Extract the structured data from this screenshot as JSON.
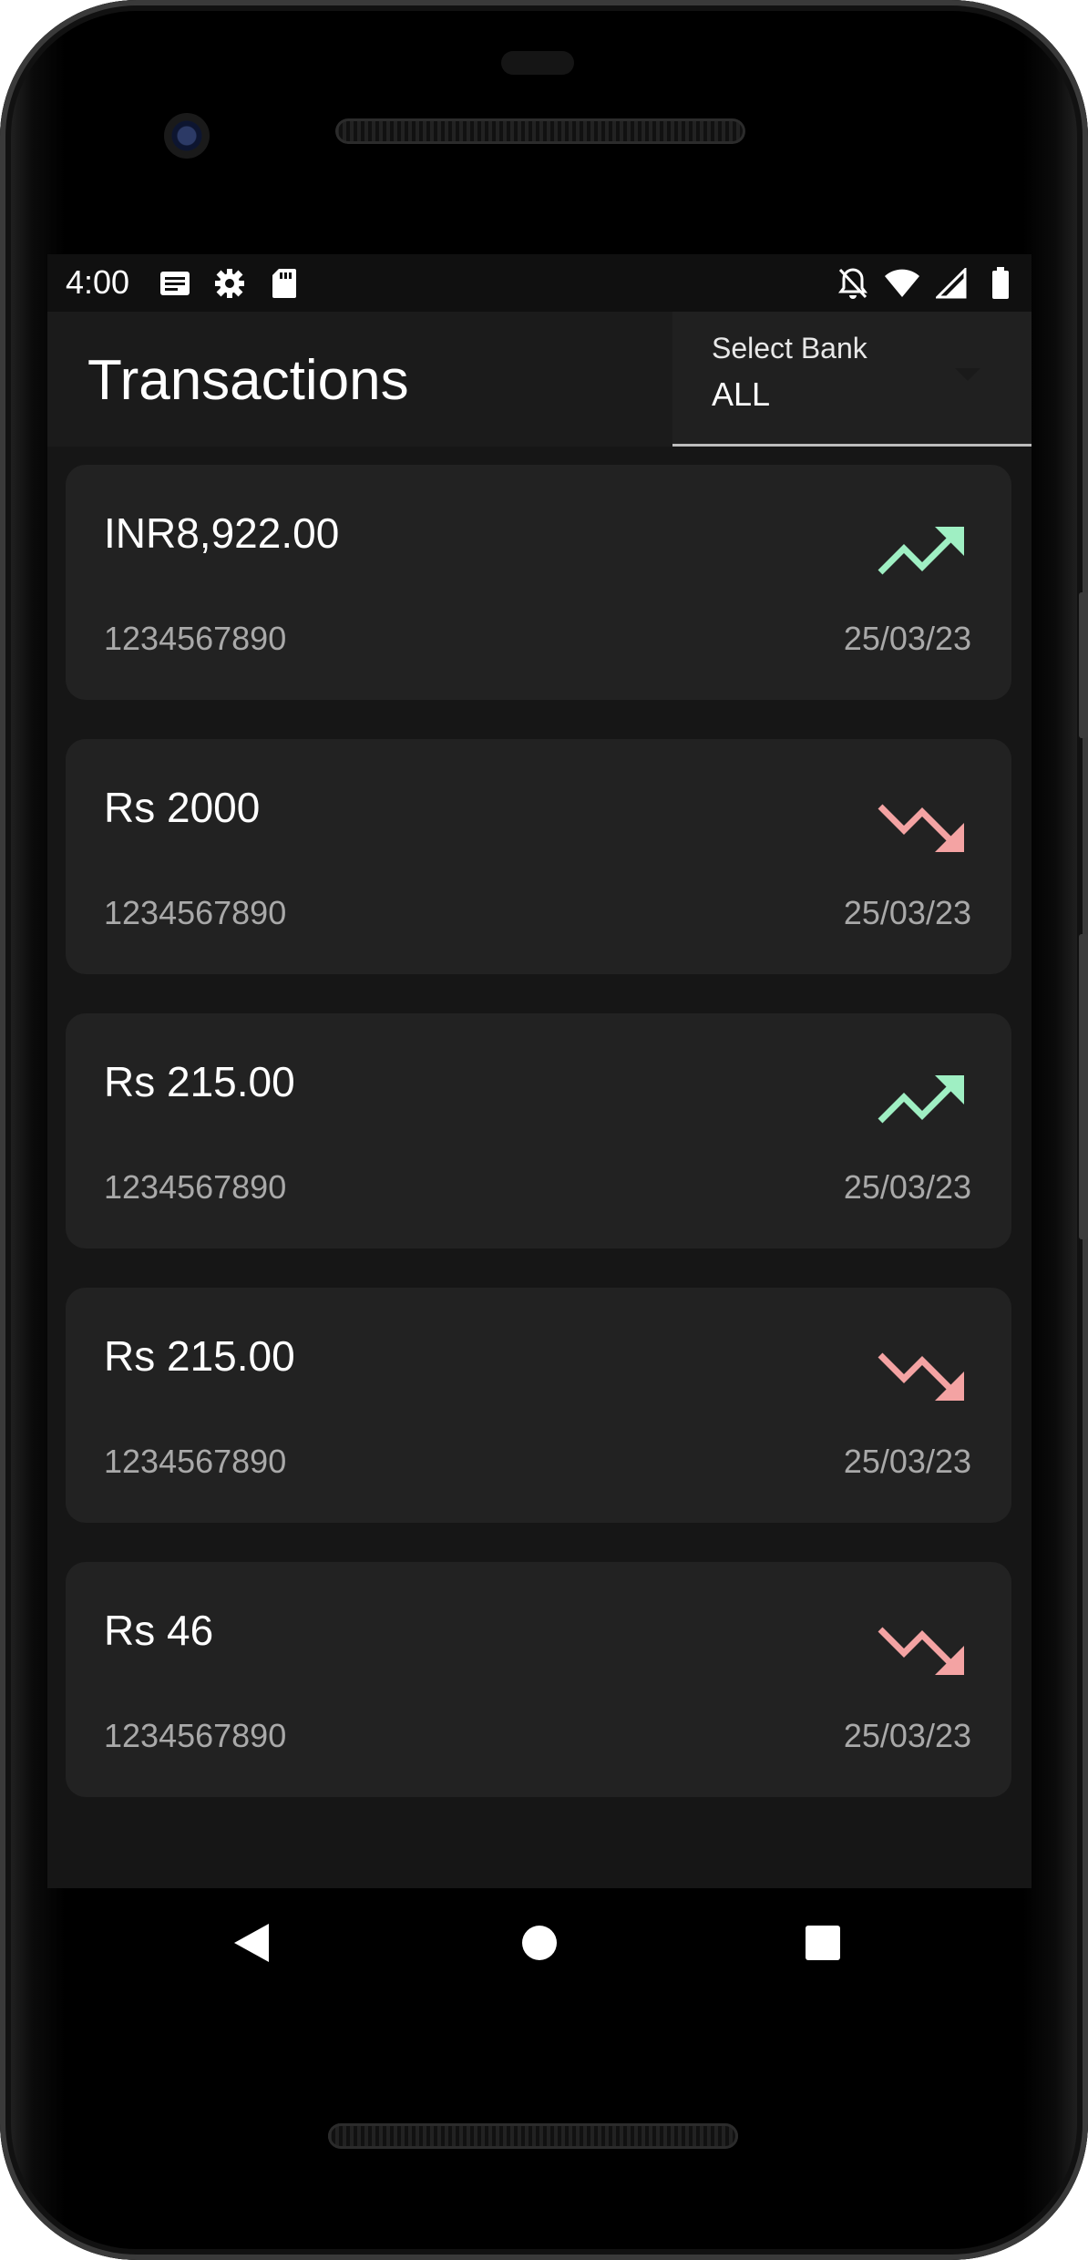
{
  "status_bar": {
    "time": "4:00",
    "left_icons": [
      "news-icon",
      "settings-icon",
      "sd-card-icon"
    ],
    "right_icons": [
      "notifications-off-icon",
      "wifi-icon",
      "signal-icon",
      "battery-icon"
    ]
  },
  "header": {
    "title": "Transactions",
    "bank_select": {
      "label": "Select Bank",
      "value": "ALL"
    }
  },
  "transactions": [
    {
      "amount": "INR8,922.00",
      "account": "1234567890",
      "date": "25/03/23",
      "direction": "credit",
      "icon": "trending-up-icon"
    },
    {
      "amount": "Rs 2000",
      "account": "1234567890",
      "date": "25/03/23",
      "direction": "debit",
      "icon": "trending-down-icon"
    },
    {
      "amount": "Rs 215.00",
      "account": "1234567890",
      "date": "25/03/23",
      "direction": "credit",
      "icon": "trending-up-icon"
    },
    {
      "amount": "Rs 215.00",
      "account": "1234567890",
      "date": "25/03/23",
      "direction": "debit",
      "icon": "trending-down-icon"
    },
    {
      "amount": "Rs 46",
      "account": "1234567890",
      "date": "25/03/23",
      "direction": "debit",
      "icon": "trending-down-icon"
    }
  ],
  "colors": {
    "credit": "#9FEFC3",
    "debit": "#F4A3A3",
    "card_background": "#222222",
    "screen_background": "#161616"
  },
  "nav_bar": {
    "buttons": [
      "back-icon",
      "home-icon",
      "recents-icon"
    ]
  }
}
